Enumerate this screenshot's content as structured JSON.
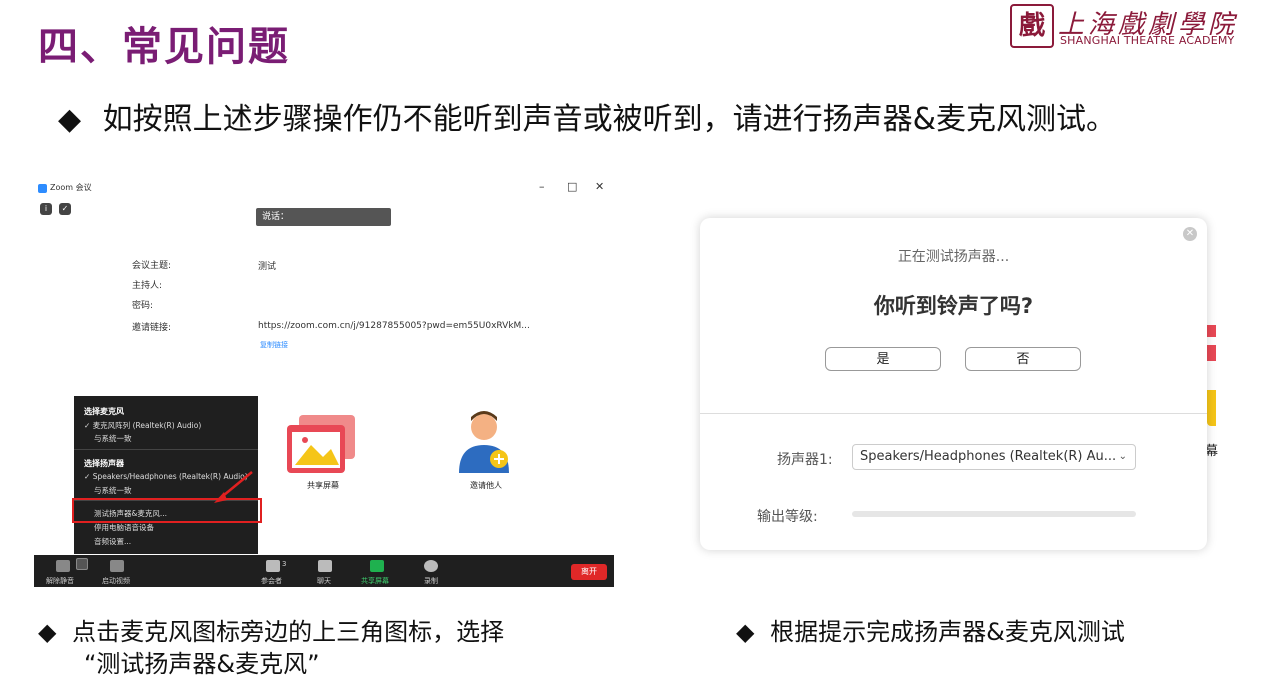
{
  "slide": {
    "title": "四、常见问题",
    "bullet_symbol": "◆",
    "main_text": "如按照上述步骤操作仍不能听到声音或被听到，请进行扬声器&麦克风测试。",
    "logo": {
      "seal_char": "戲",
      "chinese_name": "上海戲劇學院",
      "english_name": "SHANGHAI THEATRE ACADEMY"
    },
    "note_left_line1": "点击麦克风图标旁边的上三角图标，选择",
    "note_left_line2": "“测试扬声器&麦克风”",
    "note_right": "根据提示完成扬声器&麦克风测试"
  },
  "zoom_window": {
    "title": "Zoom 会议",
    "controls": {
      "minimize": "–",
      "maximize": "□",
      "close": "✕"
    },
    "speaking_label": "说话：",
    "info": {
      "topic_label": "会议主题:",
      "topic_value": "测试",
      "host_label": "主持人:",
      "password_label": "密码:",
      "invite_link_label": "邀请链接:",
      "invite_link_value": "https://zoom.com.cn/j/91287855005?pwd=em55U0xRVkM...",
      "copy_link": "复制链接"
    },
    "audio_menu": {
      "mic_header": "选择麦克风",
      "mic_option_1": "麦克风阵列 (Realtek(R) Audio)",
      "mic_option_2": "与系统一致",
      "speaker_header": "选择扬声器",
      "speaker_option_1": "Speakers/Headphones (Realtek(R) Audio)",
      "speaker_option_2": "与系统一致",
      "test_item": "测试扬声器&麦克风...",
      "leave_audio": "停用电脑语音设备",
      "audio_settings": "音频设置...",
      "check_mark": "✓"
    },
    "share_screen_label": "共享屏幕",
    "invite_label": "邀请他人",
    "toolbar": {
      "unmute": "解除静音",
      "start_video": "启动视频",
      "participants": "参会者",
      "participants_count": "3",
      "chat": "聊天",
      "share": "共享屏幕",
      "record": "录制",
      "leave": "离开"
    }
  },
  "test_dialog": {
    "subtitle": "正在测试扬声器...",
    "question": "你听到铃声了吗?",
    "yes_button": "是",
    "no_button": "否",
    "speaker_label": "扬声器1:",
    "speaker_value": "Speakers/Headphones (Realtek(R) Au...",
    "output_level_label": "输出等级:",
    "output_level": 0,
    "peek_text": "幕"
  },
  "colors": {
    "title_purple": "#7a1d74",
    "logo_red": "#8b1a3a",
    "highlight_red": "#e02020",
    "zoom_blue": "#2d8cff"
  }
}
